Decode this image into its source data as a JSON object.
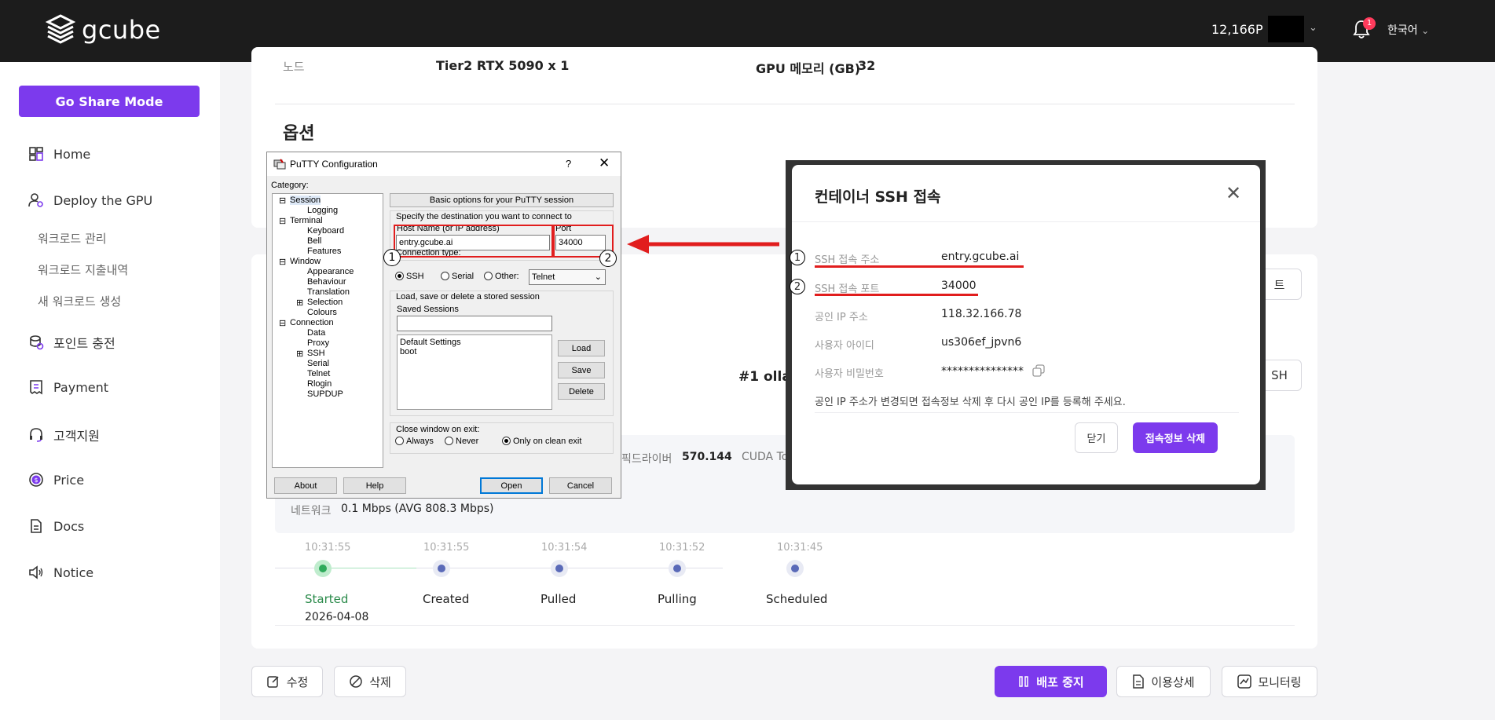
{
  "header": {
    "logo_text": "gcube",
    "points": "12,166P",
    "notification_count": "1",
    "language": "한국어"
  },
  "sidebar": {
    "share_button": "Go Share Mode",
    "items": [
      {
        "label": "Home",
        "icon": "home-grid-icon"
      },
      {
        "label": "Deploy the GPU",
        "icon": "user-gear-icon"
      },
      {
        "label": "포인트 충전",
        "icon": "coins-icon"
      },
      {
        "label": "Payment",
        "icon": "receipt-icon"
      },
      {
        "label": "고객지원",
        "icon": "headset-icon"
      },
      {
        "label": "Price",
        "icon": "dollar-icon"
      },
      {
        "label": "Docs",
        "icon": "document-icon"
      },
      {
        "label": "Notice",
        "icon": "speaker-icon"
      }
    ],
    "sub_items": [
      "워크로드 관리",
      "워크로드 지출내역",
      "새 워크로드 생성"
    ]
  },
  "main": {
    "node_label": "노드",
    "node_value": "Tier2 RTX 5090 x 1",
    "gpu_mem_label": "GPU 메모리 (GB)",
    "gpu_mem_value": "32",
    "options_title": "옵션",
    "workload_name_partial": "#1 ollan",
    "driver_label": "픽드라이버",
    "driver_value": "570.144",
    "cuda_label": "CUDA To",
    "network_label": "네트워크",
    "network_value": "0.1 Mbps (AVG 808.3 Mbps)",
    "right_btn_partial_1": "트",
    "right_btn_partial_2": "SH",
    "timeline": [
      {
        "time": "10:31:55",
        "label": "Started",
        "date": "2026-04-08"
      },
      {
        "time": "10:31:55",
        "label": "Created"
      },
      {
        "time": "10:31:54",
        "label": "Pulled"
      },
      {
        "time": "10:31:52",
        "label": "Pulling"
      },
      {
        "time": "10:31:45",
        "label": "Scheduled"
      }
    ]
  },
  "actions": {
    "edit": "수정",
    "delete": "삭제",
    "stop": "배포 중지",
    "usage": "이용상세",
    "monitoring": "모니터링"
  },
  "putty": {
    "title": "PuTTY Configuration",
    "help_glyph": "?",
    "category_label": "Category:",
    "tree": [
      "Session",
      "Logging",
      "Terminal",
      "Keyboard",
      "Bell",
      "Features",
      "Window",
      "Appearance",
      "Behaviour",
      "Translation",
      "Selection",
      "Colours",
      "Connection",
      "Data",
      "Proxy",
      "SSH",
      "Serial",
      "Telnet",
      "Rlogin",
      "SUPDUP"
    ],
    "basic_options": "Basic options for your PuTTY session",
    "specify_dest": "Specify the destination you want to connect to",
    "host_label": "Host Name (or IP address)",
    "host_value": "entry.gcube.ai",
    "port_label": "Port",
    "port_value": "34000",
    "conn_type_label": "Connection type:",
    "conn_ssh": "SSH",
    "conn_serial": "Serial",
    "conn_other": "Other:",
    "conn_other_value": "Telnet",
    "load_save_label": "Load, save or delete a stored session",
    "saved_sessions_label": "Saved Sessions",
    "sessions": [
      "Default Settings",
      "boot"
    ],
    "btn_load": "Load",
    "btn_save": "Save",
    "btn_delete": "Delete",
    "close_window_label": "Close window on exit:",
    "close_always": "Always",
    "close_never": "Never",
    "close_clean": "Only on clean exit",
    "btn_about": "About",
    "btn_help": "Help",
    "btn_open": "Open",
    "btn_cancel": "Cancel",
    "marker_1": "1",
    "marker_2": "2"
  },
  "ssh_modal": {
    "title": "컨테이너 SSH 접속",
    "rows": [
      {
        "label": "SSH 접속 주소",
        "value": "entry.gcube.ai"
      },
      {
        "label": "SSH 접속 포트",
        "value": "34000"
      },
      {
        "label": "공인 IP 주소",
        "value": "118.32.166.78"
      },
      {
        "label": "사용자 아이디",
        "value": "us306ef_jpvn6"
      },
      {
        "label": "사용자 비밀번호",
        "value": "***************"
      }
    ],
    "note": "공인 IP 주소가 변경되면 접속정보 삭제 후 다시 공인 IP를 등록해 주세요.",
    "btn_close": "닫기",
    "btn_delete": "접속정보 삭제",
    "marker_1": "1",
    "marker_2": "2"
  },
  "colors": {
    "brand_purple": "#7c3aed",
    "annotation_red": "#e11d1d",
    "header_bg": "#1c1c1c"
  }
}
